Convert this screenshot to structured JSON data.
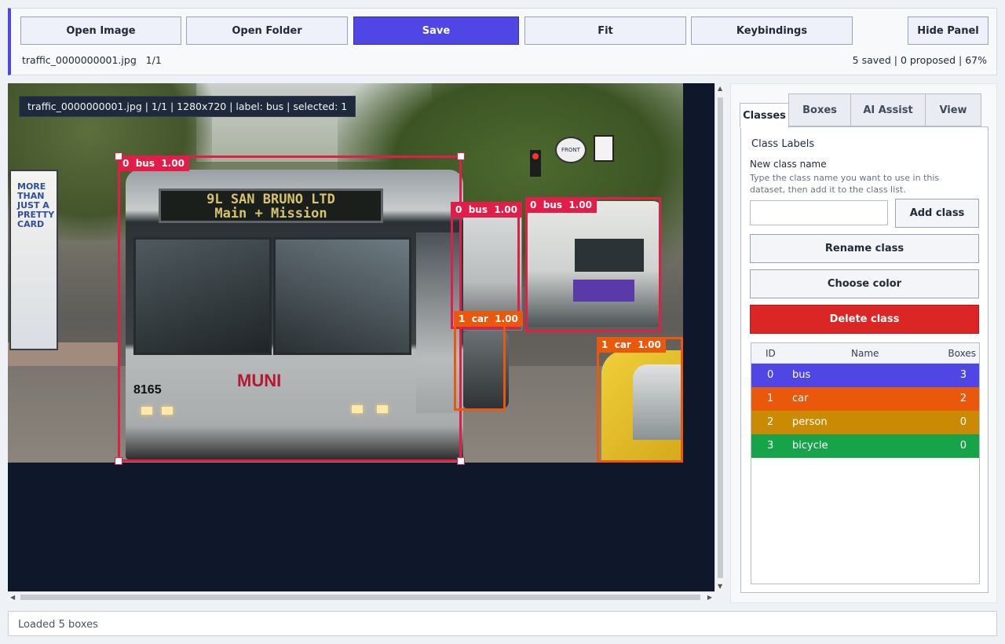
{
  "toolbar": {
    "buttons": [
      "Open Image",
      "Open Folder",
      "Save",
      "Fit",
      "Keybindings"
    ],
    "hide_panel": "Hide Panel",
    "file_info": "traffic_0000000001.jpg   1/1",
    "summary": "5 saved | 0 proposed | 67%"
  },
  "canvas": {
    "overlay": "traffic_0000000001.jpg | 1/1 | 1280x720 | label: bus | selected: 1",
    "photo_text": {
      "bus_sign_line1": "9L SAN BRUNO LTD",
      "bus_sign_line2": "Main + Mission",
      "bus_number": "8165",
      "kiosk": "MORE THAN JUST A PRETTY CARD",
      "sign_front": "FRONT"
    },
    "boxes": [
      {
        "label": "0  bus  1.00",
        "cls": "bus"
      },
      {
        "label": "0  bus  1.00",
        "cls": "bus"
      },
      {
        "label": "0  bus  1.00",
        "cls": "bus"
      },
      {
        "label": "1  car  1.00",
        "cls": "car"
      },
      {
        "label": "1  car  1.00",
        "cls": "car"
      }
    ]
  },
  "panel": {
    "tabs": [
      "Classes",
      "Boxes",
      "AI Assist",
      "View"
    ],
    "active_tab": "Classes",
    "section_title": "Class Labels",
    "new_class_label": "New class name",
    "help_text": "Type the class name you want to use in this dataset, then add it to the class list.",
    "new_class_value": "",
    "add_class": "Add class",
    "rename_class": "Rename class",
    "choose_color": "Choose color",
    "delete_class": "Delete class",
    "table_headers": {
      "id": "ID",
      "name": "Name",
      "boxes": "Boxes"
    },
    "classes": [
      {
        "id": "0",
        "name": "bus",
        "boxes": "3",
        "color": "#4f46e5"
      },
      {
        "id": "1",
        "name": "car",
        "boxes": "2",
        "color": "#ea580c"
      },
      {
        "id": "2",
        "name": "person",
        "boxes": "0",
        "color": "#ca8a04"
      },
      {
        "id": "3",
        "name": "bicycle",
        "boxes": "0",
        "color": "#16a34a"
      }
    ]
  },
  "status": "Loaded 5 boxes",
  "colors": {
    "accent": "#4f46e5",
    "bus_box": "#e11d48",
    "car_box": "#ea580c",
    "danger": "#dc2626"
  }
}
